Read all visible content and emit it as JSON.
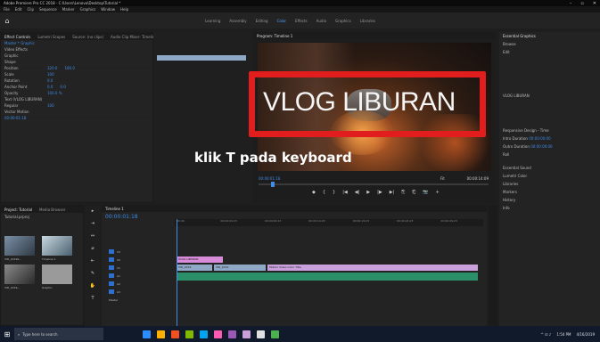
{
  "window": {
    "title": "Adobe Premiere Pro CC 2018 - C:\\Users\\Lenovo\\Desktop\\Tutorial *"
  },
  "menu": [
    "File",
    "Edit",
    "Clip",
    "Sequence",
    "Marker",
    "Graphics",
    "Window",
    "Help"
  ],
  "workspaces": {
    "items": [
      "Learning",
      "Assembly",
      "Editing",
      "Color",
      "Effects",
      "Audio",
      "Graphics",
      "Libraries"
    ],
    "active_index": 3
  },
  "effect_controls": {
    "tabs": [
      "Effect Controls",
      "Lumetri Scopes",
      "Source: (no clips)",
      "Audio Clip Mixer: Timeline 1"
    ],
    "sequence": "Master * Graphic",
    "rows": [
      {
        "label": "Video Effects",
        "values": []
      },
      {
        "label": "Graphic",
        "values": []
      },
      {
        "label": "Shape",
        "values": []
      },
      {
        "label": "Position",
        "values": [
          "320.0",
          "180.0"
        ]
      },
      {
        "label": "Scale",
        "values": [
          "100"
        ]
      },
      {
        "label": "Rotation",
        "values": [
          "0.0"
        ]
      },
      {
        "label": "Anchor Point",
        "values": [
          "0.0",
          "0.0"
        ]
      },
      {
        "label": "Opacity",
        "values": [
          "100.0 %"
        ]
      },
      {
        "label": "Text (VLOG LIBURAN)",
        "values": []
      },
      {
        "label": "Regular",
        "values": [
          "100"
        ]
      },
      {
        "label": "Vector Motion",
        "values": []
      }
    ],
    "timecode": "00:00:01:18"
  },
  "program": {
    "tab": "Program: Timeline 1",
    "title_text": "VLOG LIBURAN",
    "annotation": "klik T pada keyboard",
    "timecode": "00:00:01:18",
    "fit": "Fit",
    "duration": "00:00:14:09",
    "transport": [
      "◆",
      "{",
      "}",
      "|◀",
      "◀|",
      "▶",
      "|▶",
      "▶|",
      "⎘",
      "⎗",
      "📷",
      "+"
    ]
  },
  "essential_graphics": {
    "title": "Essential Graphics",
    "sections": [
      "Browse",
      "Edit",
      "VLOG LIBURAN",
      "Responsive Design - Time",
      "Intro Duration",
      "Outro Duration",
      "Roll",
      "Essential Sound",
      "Lumetri Color",
      "Libraries",
      "Markers",
      "History",
      "Info"
    ],
    "values": [
      "00:00:00:00",
      "00:00:00:00"
    ]
  },
  "project": {
    "tabs": [
      "Project: Tutorial",
      "Media Browser"
    ],
    "name": "Tutorial.prproj",
    "items": [
      {
        "label": "VID_20190...",
        "dur": "9:07"
      },
      {
        "label": "Timeline 1",
        "dur": "14:09"
      },
      {
        "label": "VID_2019...",
        "dur": "5:01"
      },
      {
        "label": "Graphic",
        "dur": "4:29"
      }
    ]
  },
  "timeline": {
    "tab": "Timeline 1",
    "timecode": "00:00:01:18",
    "ruler": [
      "00:00",
      "00:00:04:23",
      "00:00:09:23",
      "00:00:14:23",
      "00:00:19:23",
      "00:00:24:23",
      "00:00:29:23"
    ],
    "tracks": [
      "V3",
      "V2",
      "V1",
      "A1",
      "A2",
      "A3",
      "Master"
    ],
    "clips": [
      {
        "label": "VLOG LIBURAN",
        "color": "#d78bd8"
      },
      {
        "label": "VID_2019",
        "color": "#8fa8c6"
      },
      {
        "label": "VID_2019",
        "color": "#8fa8c6"
      },
      {
        "label": "Motion Video Color Title",
        "color": "#c9a0dc"
      }
    ]
  },
  "tools": [
    "▸",
    "⇥",
    "↔",
    "⌀",
    "⇤",
    "✎",
    "✋",
    "T"
  ],
  "taskbar": {
    "search_placeholder": "Type here to search",
    "time": "1:54 PM",
    "date": "4/16/2019",
    "apps": [
      "#2d8cff",
      "#ffb000",
      "#f25022",
      "#7fba00",
      "#00a4ef",
      "#ff5ab1",
      "#9b59b6",
      "#c9a0dc",
      "#e0e0e0",
      "#4caf50"
    ]
  }
}
